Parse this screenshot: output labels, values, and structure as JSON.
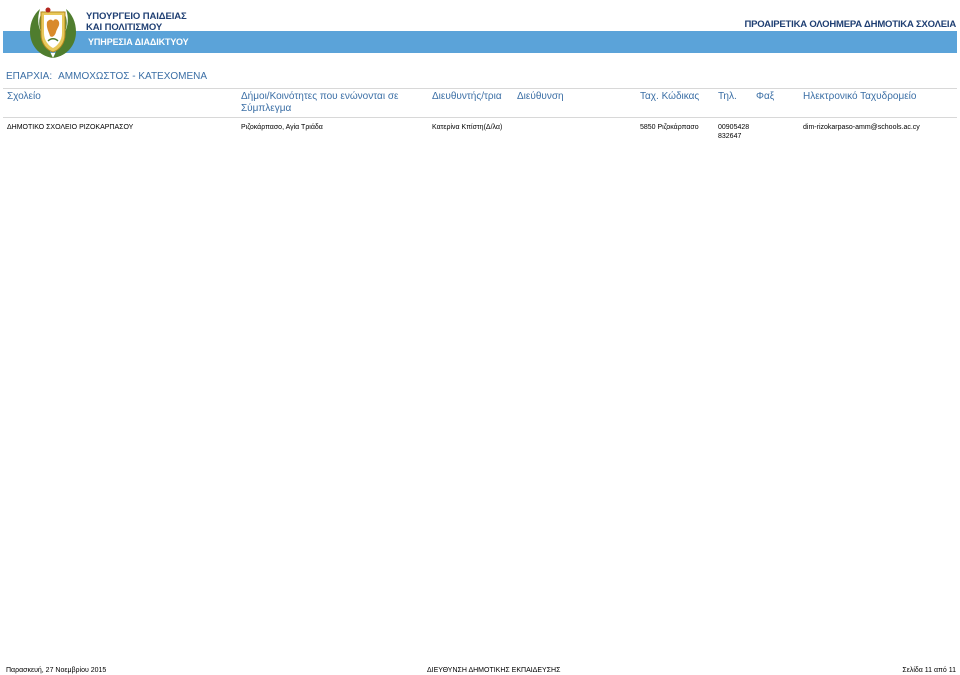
{
  "header": {
    "ministry_line1": "ΥΠΟΥΡΓΕΙΟ ΠΑΙΔΕΙΑΣ",
    "ministry_line2": "ΚΑΙ ΠΟΛΙΤΙΣΜΟΥ",
    "service": "ΥΠΗΡΕΣΙΑ ΔΙΑΔΙΚΤΥΟΥ",
    "doc_title": "ΠΡΟΑΙΡΕΤΙΚΑ ΟΛΟΗΜΕΡΑ ΔΗΜΟΤΙΚΑ ΣΧΟΛΕΙΑ",
    "band_color": "#5ba3d9",
    "logo_icon": "cyprus-coat-of-arms-icon"
  },
  "district": {
    "label": "ΕΠΑΡΧΙΑ:",
    "value": "ΑΜΜΟΧΩΣΤΟΣ - ΚΑΤΕΧΟΜΕΝΑ"
  },
  "columns": {
    "school": "Σχολείο",
    "communities": "Δήμοι/Κοινότητες που ενώνονται σε Σύμπλεγμα",
    "principal": "Διευθυντής/τρια",
    "address": "Διεύθυνση",
    "postal": "Ταχ. Κώδικας",
    "phone": "Τηλ.",
    "fax": "Φαξ",
    "email": "Ηλεκτρονικό Ταχυδρομείο"
  },
  "rows": [
    {
      "school": "ΔΗΜΟΤΙΚΟ ΣΧΟΛΕΙΟ ΡΙΖΟΚΑΡΠΑΣΟΥ",
      "communities": "Ριζοκάρπασο, Αγία Τριάδα",
      "principal": "Κατερίνα Κπίστη(Δ/λα)",
      "address": "",
      "postal": "5850 Ριζοκάρπασο",
      "phone_line1": "00905428",
      "phone_line2": "832647",
      "fax": "",
      "email": "dim-rizokarpaso-amm@schools.ac.cy"
    }
  ],
  "footer": {
    "date": "Παρασκευή, 27 Νοεμβρίου 2015",
    "department": "ΔΙΕΥΘΥΝΣΗ ΔΗΜΟΤΙΚΗΣ ΕΚΠΑΙΔΕΥΣΗΣ",
    "page": "Σελίδα 11 από 11"
  }
}
